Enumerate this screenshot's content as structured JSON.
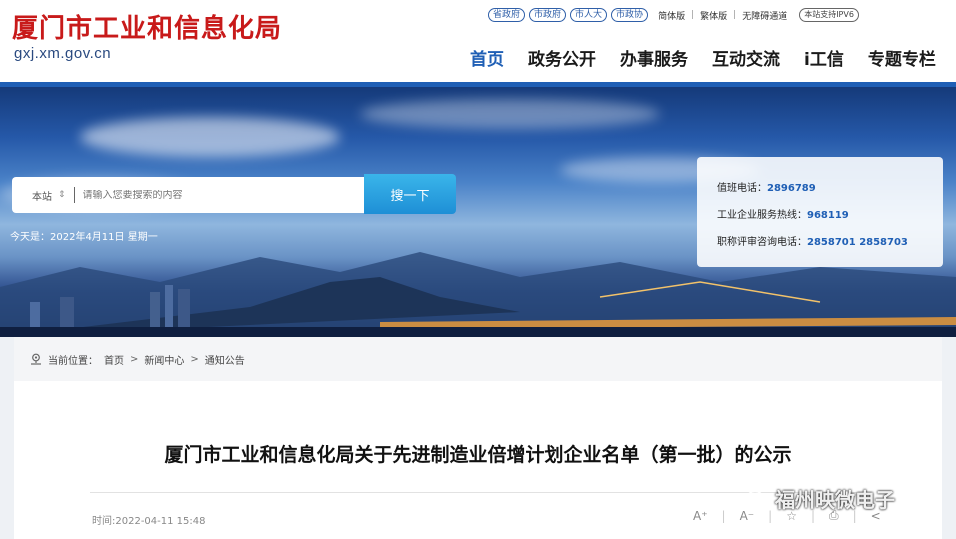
{
  "header": {
    "title": "厦门市工业和信息化局",
    "domain": "gxj.xm.gov.cn",
    "top_pills": [
      "省政府",
      "市政府",
      "市人大",
      "市政协"
    ],
    "lang_links": [
      "简体版",
      "繁体版",
      "无障碍通道"
    ],
    "ipv6_badge": "本站支持IPV6",
    "nav": [
      "首页",
      "政务公开",
      "办事服务",
      "互动交流",
      "i工信",
      "专题专栏"
    ]
  },
  "banner": {
    "search_scope": "本站",
    "search_placeholder": "请输入您要搜索的内容",
    "search_button": "搜一下",
    "date_text": "今天是：2022年4月11日 星期一",
    "hotlines": [
      {
        "label": "值班电话：",
        "value": "2896789"
      },
      {
        "label": "工业企业服务热线：",
        "value": "968119"
      },
      {
        "label": "职称评审咨询电话：",
        "value": "2858701 2858703"
      }
    ]
  },
  "breadcrumb": {
    "label": "当前位置：",
    "items": [
      "首页",
      "新闻中心",
      "通知公告"
    ]
  },
  "article": {
    "title": "厦门市工业和信息化局关于先进制造业倍增计划企业名单（第一批）的公示",
    "time": "时间:2022-04-11 15:48",
    "tools": [
      "A⁺",
      "A⁻"
    ]
  },
  "watermark": "福州映微电子",
  "colors": {
    "brand_red": "#c81a1a",
    "brand_blue": "#1f5fb5",
    "search_btn": "#1e8fd6"
  }
}
